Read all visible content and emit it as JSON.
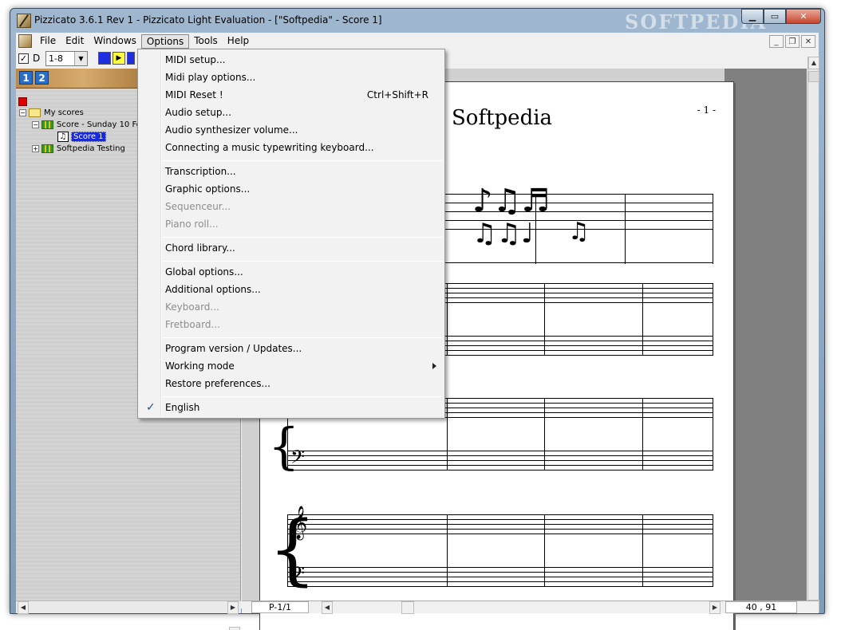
{
  "window": {
    "title": "Pizzicato 3.6.1 Rev 1 - Pizzicato Light Evaluation - [\"Softpedia\" - Score 1]",
    "watermark": "SOFTPEDIA"
  },
  "menubar": {
    "items": [
      "File",
      "Edit",
      "Windows",
      "Options",
      "Tools",
      "Help"
    ],
    "active": "Options"
  },
  "toolbar": {
    "checkbox_label": "D",
    "range_value": "1-8"
  },
  "left_panel": {
    "page_tabs": [
      "1",
      "2"
    ],
    "tree": [
      {
        "label": "My scores"
      },
      {
        "label": "Score - Sunday 10 Fe"
      },
      {
        "label": "Score 1"
      },
      {
        "label": "Softpedia Testing"
      }
    ]
  },
  "score": {
    "title": "Softpedia",
    "page_number": "- 1 -"
  },
  "status": {
    "page": "P-1/1",
    "coords": "40 , 91"
  },
  "options_menu": {
    "items": [
      {
        "label": "MIDI setup..."
      },
      {
        "label": "Midi play options..."
      },
      {
        "label": "MIDI Reset !",
        "shortcut": "Ctrl+Shift+R"
      },
      {
        "label": "Audio setup..."
      },
      {
        "label": "Audio synthesizer volume..."
      },
      {
        "label": "Connecting a music typewriting keyboard..."
      },
      {
        "label": "Transcription..."
      },
      {
        "label": "Graphic options..."
      },
      {
        "label": "Sequenceur..."
      },
      {
        "label": "Piano roll..."
      },
      {
        "label": "Chord library..."
      },
      {
        "label": "Global options..."
      },
      {
        "label": "Additional options..."
      },
      {
        "label": "Keyboard..."
      },
      {
        "label": "Fretboard..."
      },
      {
        "label": "Program version / Updates..."
      },
      {
        "label": "Working mode"
      },
      {
        "label": "Restore preferences..."
      },
      {
        "label": "English"
      }
    ]
  },
  "colors": {
    "accent": "#1a2ad8",
    "tab_blue": "#2a6ec9",
    "disabled_text": "#8d8d8d"
  }
}
